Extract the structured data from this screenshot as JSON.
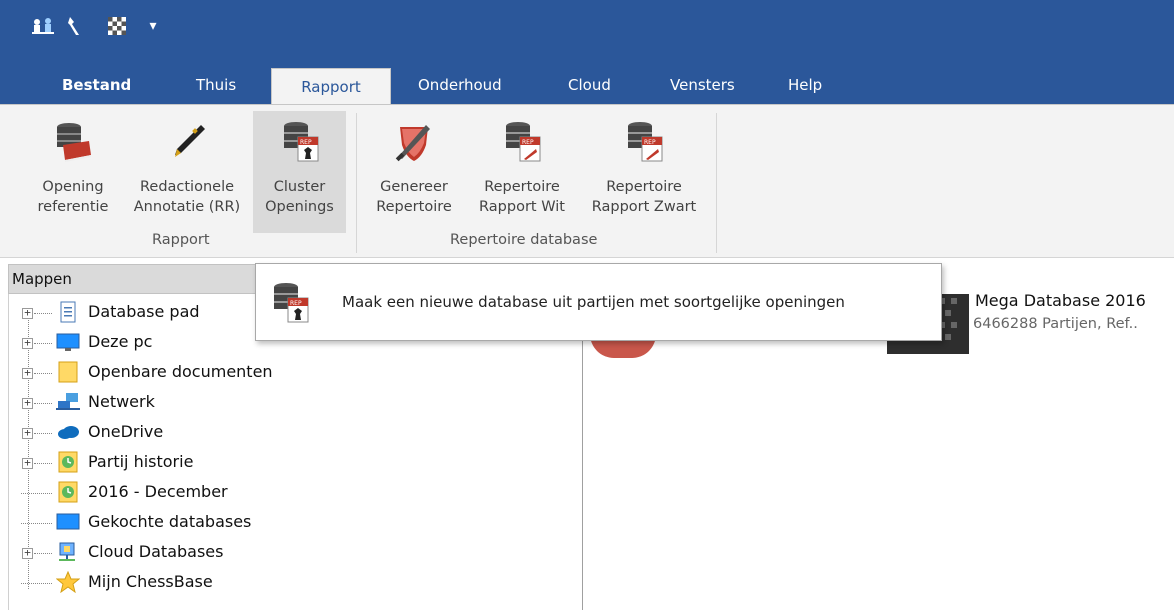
{
  "colors": {
    "accent": "#2b579a",
    "ribbon_bg": "#f3f3f3",
    "selected": "#dadada"
  },
  "quick_access": [
    {
      "icon": "chess-pieces-icon"
    },
    {
      "icon": "wrench-icon"
    },
    {
      "icon": "chessboard-icon"
    },
    {
      "icon": "customize-dropdown-icon",
      "label": "▾"
    }
  ],
  "tabs": {
    "file": "Bestand",
    "home": "Thuis",
    "report": "Rapport",
    "maintenance": "Onderhoud",
    "cloud": "Cloud",
    "windows": "Vensters",
    "help": "Help"
  },
  "ribbon": {
    "groups": [
      {
        "label": "Rapport"
      },
      {
        "label": "Repertoire database"
      }
    ],
    "buttons": {
      "opening_reference": [
        "Opening",
        "referentie"
      ],
      "editorial_annotation": [
        "Redactionele",
        "Annotatie (RR)"
      ],
      "cluster_openings": [
        "Cluster",
        "Openings"
      ],
      "generate_repertoire": [
        "Genereer",
        "Repertoire"
      ],
      "report_white": [
        "Repertoire",
        "Rapport Wit"
      ],
      "report_black": [
        "Repertoire",
        "Rapport Zwart"
      ]
    }
  },
  "left_panel": {
    "header": "Mappen",
    "tree": [
      {
        "label": "Database pad",
        "icon": "document-icon",
        "expandable": true
      },
      {
        "label": "Deze pc",
        "icon": "monitor-icon",
        "expandable": true
      },
      {
        "label": "Openbare documenten",
        "icon": "folder-icon",
        "expandable": true
      },
      {
        "label": "Netwerk",
        "icon": "network-icon",
        "expandable": true
      },
      {
        "label": "OneDrive",
        "icon": "onedrive-cloud-icon",
        "expandable": true
      },
      {
        "label": "Partij historie",
        "icon": "history-clock-icon",
        "expandable": true
      },
      {
        "label": "2016 - December",
        "icon": "history-clock-icon",
        "expandable": false
      },
      {
        "label": "Gekochte databases",
        "icon": "monitor-icon",
        "expandable": false
      },
      {
        "label": "Cloud Databases",
        "icon": "cloud-database-icon",
        "expandable": true
      },
      {
        "label": "Mijn ChessBase",
        "icon": "star-icon",
        "expandable": false
      }
    ],
    "expand_symbol": "+"
  },
  "database_item": {
    "title": "Mega Database 2016",
    "subtitle": "6466288 Partijen, Ref.."
  },
  "tooltip": {
    "text": "Maak een nieuwe database uit partijen met soortgelijke openingen"
  }
}
